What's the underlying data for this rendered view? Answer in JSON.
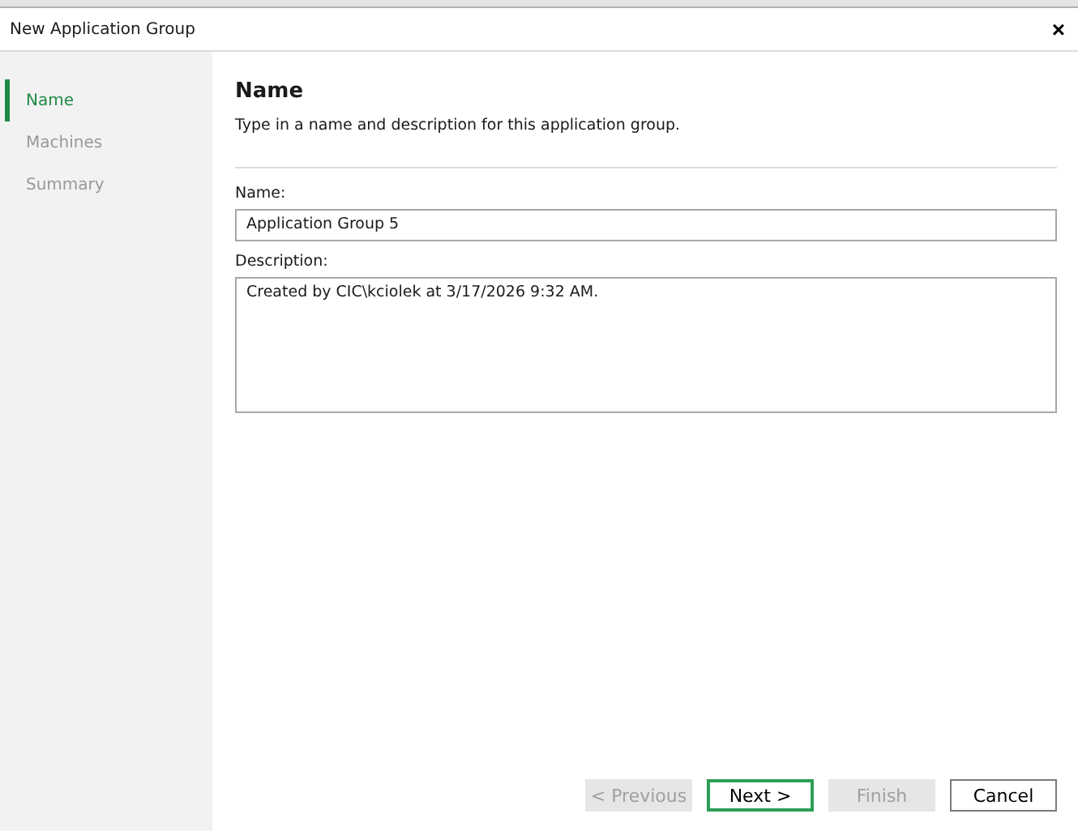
{
  "window": {
    "title": "New Application Group",
    "close": "×"
  },
  "steps": [
    {
      "label": "Name",
      "selected": true
    },
    {
      "label": "Machines",
      "selected": false
    },
    {
      "label": "Summary",
      "selected": false
    }
  ],
  "page": {
    "heading": "Name",
    "subtitle": "Type in a name and description for this application group."
  },
  "fields": [
    {
      "label": "Name:",
      "value": "Application Group 5",
      "kind": "line"
    },
    {
      "label": "Description:",
      "value": "Created by CIC\\kciolek at 3/17/2026 9:32 AM.",
      "kind": "area"
    }
  ],
  "buttons": [
    {
      "label": "< Previous",
      "disabled": true,
      "default": false
    },
    {
      "label": "Next >",
      "disabled": false,
      "default": true
    },
    {
      "label": "Finish",
      "disabled": true,
      "default": false
    },
    {
      "label": "Cancel",
      "disabled": false,
      "default": false
    }
  ]
}
